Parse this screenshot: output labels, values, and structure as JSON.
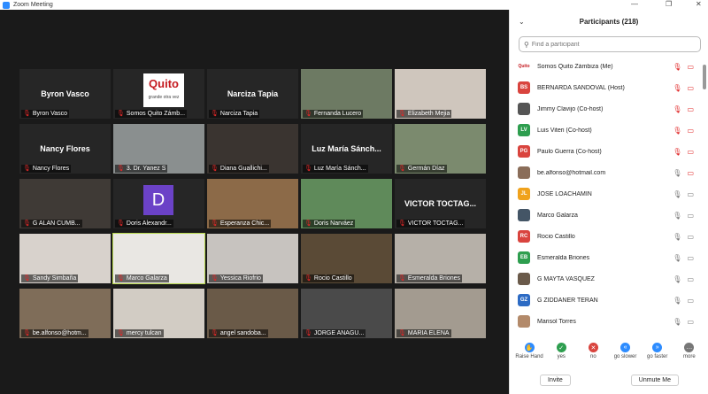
{
  "window": {
    "title": "Zoom Meeting",
    "minimize": "—",
    "maximize": "❐",
    "close": "✕"
  },
  "tiles": [
    {
      "bigname": "Byron Vasco",
      "label": "Byron Vasco",
      "type": "name"
    },
    {
      "label": "Somos Quito Zámb...",
      "type": "logo",
      "logo_text": "Quito",
      "logo_sub": "grande otra vez"
    },
    {
      "bigname": "Narciza Tapia",
      "label": "Narciza Tapia",
      "type": "name"
    },
    {
      "label": "Fernanda Lucero",
      "type": "video",
      "bg": "#6d7a63"
    },
    {
      "label": "Elizabeth Mejia",
      "type": "video",
      "bg": "#cfc6bd"
    },
    {
      "bigname": "Nancy Flores",
      "label": "Nancy Flores",
      "type": "name"
    },
    {
      "label": "3. Dr. Yanez S",
      "type": "video",
      "bg": "#8a8f8f"
    },
    {
      "label": "Diana Guallichi...",
      "type": "video",
      "bg": "#3a3430"
    },
    {
      "bigname": "Luz María Sánch...",
      "label": "Luz María Sánch...",
      "type": "name"
    },
    {
      "label": "Germán Díaz",
      "type": "video",
      "bg": "#7b8a6e"
    },
    {
      "label": "G ALAN CUMB...",
      "type": "video",
      "bg": "#3f3a36"
    },
    {
      "label": "Doris Alexandr...",
      "type": "avatar",
      "avatar_letter": "D"
    },
    {
      "label": "Esperanza Chic...",
      "type": "video",
      "bg": "#8c6a48"
    },
    {
      "label": "Doris Narváez",
      "type": "video",
      "bg": "#5f8a5a"
    },
    {
      "bigname": "VICTOR TOCTAG...",
      "label": "VICTOR TOCTAG...",
      "type": "name"
    },
    {
      "label": "Sandy Simbaña",
      "type": "video",
      "bg": "#d8d2cc"
    },
    {
      "label": "Marco Galarza",
      "type": "video",
      "bg": "#e9e7e3",
      "active": true
    },
    {
      "label": "Yessica Riofrio",
      "type": "video",
      "bg": "#c7c3bf"
    },
    {
      "label": "Rocio Castillo",
      "type": "video",
      "bg": "#5a4a36"
    },
    {
      "label": "Esmeralda Briones",
      "type": "video",
      "bg": "#b6b0a8"
    },
    {
      "label": "be.alfonso@hotm...",
      "type": "video",
      "bg": "#7f6d59"
    },
    {
      "label": "mercy tulcan",
      "type": "video",
      "bg": "#d2ccc4"
    },
    {
      "label": "angel sandoba...",
      "type": "video",
      "bg": "#6a5a48"
    },
    {
      "label": "JORGE ANAGU...",
      "type": "video",
      "bg": "#4a4a4a"
    },
    {
      "label": "MARIA ELENA",
      "type": "video",
      "bg": "#a39b90"
    }
  ],
  "panel": {
    "title": "Participants (218)",
    "search_placeholder": "Find a participant",
    "participants": [
      {
        "initials": "Quito",
        "name": "Somos Quito Zámbiza (Me)",
        "color": "#ffffff",
        "mic": "off",
        "cam": "off"
      },
      {
        "initials": "BS",
        "name": "BERNARDA SANDOVAL (Host)",
        "color": "#d9443e",
        "mic": "off",
        "cam": "off"
      },
      {
        "initials": "",
        "name": "Jimmy Clavijo (Co-host)",
        "color": "#555555",
        "mic": "off",
        "cam": "off"
      },
      {
        "initials": "LV",
        "name": "Luis Viteri (Co-host)",
        "color": "#2e9e4f",
        "mic": "off",
        "cam": "off"
      },
      {
        "initials": "PG",
        "name": "Paulo Guerra (Co-host)",
        "color": "#d9443e",
        "mic": "off",
        "cam": "off"
      },
      {
        "initials": "",
        "name": "be.alfonso@hotmail.com",
        "color": "#8a6d59",
        "mic": "on",
        "cam": "off"
      },
      {
        "initials": "JL",
        "name": "JOSE LOACHAMIN",
        "color": "#f0a21c",
        "mic": "on",
        "cam": "on"
      },
      {
        "initials": "",
        "name": "Marco Galarza",
        "color": "#445566",
        "mic": "on",
        "cam": "on"
      },
      {
        "initials": "RC",
        "name": "Rocio Castillo",
        "color": "#d9443e",
        "mic": "on",
        "cam": "on"
      },
      {
        "initials": "EB",
        "name": "Esmeralda Briones",
        "color": "#2e9e4f",
        "mic": "on",
        "cam": "on"
      },
      {
        "initials": "",
        "name": "G MAYTA VASQUEZ",
        "color": "#6a5a4a",
        "mic": "on",
        "cam": "on"
      },
      {
        "initials": "GZ",
        "name": "G ZIDDANER TERÁN",
        "color": "#2d6bc4",
        "mic": "on",
        "cam": "on"
      },
      {
        "initials": "",
        "name": "Marisol Torres",
        "color": "#b38a6a",
        "mic": "on",
        "cam": "on"
      }
    ],
    "reactions": [
      {
        "label": "Raise Hand",
        "color": "#2d8cff",
        "glyph": "✋"
      },
      {
        "label": "yes",
        "color": "#2e9e4f",
        "glyph": "✓"
      },
      {
        "label": "no",
        "color": "#d9443e",
        "glyph": "✕"
      },
      {
        "label": "go slower",
        "color": "#2d8cff",
        "glyph": "«"
      },
      {
        "label": "go faster",
        "color": "#2d8cff",
        "glyph": "»"
      },
      {
        "label": "more",
        "color": "#777777",
        "glyph": "…"
      }
    ],
    "invite_label": "Invite",
    "unmute_label": "Unmute Me"
  }
}
